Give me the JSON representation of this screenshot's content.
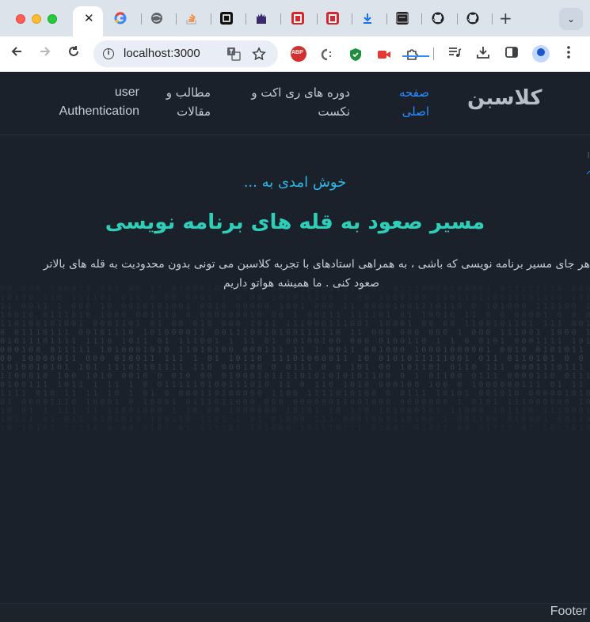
{
  "browser": {
    "tab_close_glyph": "✕",
    "new_tab_glyph": "+",
    "tab_menu_glyph": "⌄",
    "url": "localhost:3000",
    "favicons": [
      "google-icon",
      "globe-icon",
      "stackoverflow-icon",
      "notion-icon",
      "castle-icon",
      "red-app-icon",
      "red-app-icon",
      "download-icon",
      "terminal-icon",
      "github-icon",
      "github-icon"
    ],
    "extensions": [
      "abp-icon",
      "code-extension-icon",
      "shield-extension-icon",
      "camera-extension-icon",
      "puzzle-icon"
    ],
    "abp_label": "ABP"
  },
  "site": {
    "brand": "كلاسبن",
    "nav": {
      "home": "صفحه اصلی",
      "courses": "دوره های ری اکت و نکست",
      "articles": "مطالب و مقالات",
      "auth": "user Authentication"
    },
    "hero": {
      "subtitle": "خوش امدی به ...",
      "title": "مسیر صعود به قله های برنامه نویسی",
      "desc_line1": "هر جای مسیر برنامه نویسی که باشی ، به همراهی استادهای با تجربه کلاسبن می تونی بدون محدودیت به قله های بالاتر",
      "desc_line2": "صعود کنی . ما همیشه هواتو داریم"
    },
    "footer": "Footer"
  },
  "colors": {
    "page_bg": "#1b212a",
    "accent_blue": "#2a8cff",
    "subtitle_cyan": "#2fb8e6",
    "title_teal": "#2dcfb8"
  }
}
